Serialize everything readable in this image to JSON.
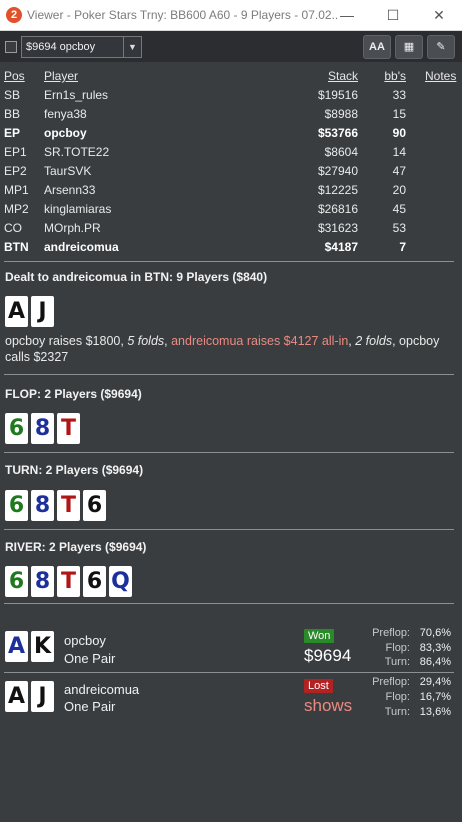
{
  "window": {
    "app_icon": "2",
    "title": "Viewer - Poker Stars Trny: BB600 A60 - 9 Players - 07.02....",
    "minimize": "—",
    "maximize": "☐",
    "close": "✕"
  },
  "toolbar": {
    "combo_value": "$9694 opcboy",
    "combo_arrow": "▼",
    "font_button": "AA",
    "grid_button": "▦",
    "edit_button": "✎"
  },
  "players": {
    "headers": {
      "pos": "Pos",
      "player": "Player",
      "stack": "Stack",
      "bbs": "bb's",
      "notes": "Notes"
    },
    "rows": [
      {
        "pos": "SB",
        "name": "Ern1s_rules",
        "stack": "$19516",
        "bbs": "33"
      },
      {
        "pos": "BB",
        "name": "fenya38",
        "stack": "$8988",
        "bbs": "15"
      },
      {
        "pos": "EP",
        "name": "opcboy",
        "stack": "$53766",
        "bbs": "90"
      },
      {
        "pos": "EP1",
        "name": "SR.TOTE22",
        "stack": "$8604",
        "bbs": "14"
      },
      {
        "pos": "EP2",
        "name": "TaurSVK",
        "stack": "$27940",
        "bbs": "47"
      },
      {
        "pos": "MP1",
        "name": "Arsenn33",
        "stack": "$12225",
        "bbs": "20"
      },
      {
        "pos": "MP2",
        "name": "kinglamiaras",
        "stack": "$26816",
        "bbs": "45"
      },
      {
        "pos": "CO",
        "name": "MOrph.PR",
        "stack": "$31623",
        "bbs": "53"
      },
      {
        "pos": "BTN",
        "name": "andreicomua",
        "stack": "$4187",
        "bbs": "7"
      }
    ]
  },
  "preflop": {
    "title": "Dealt to andreicomua in BTN: 9 Players ($840)",
    "cards": [
      "A",
      "J"
    ],
    "actions": {
      "a1": "opcboy raises $1800, ",
      "a2": "5 folds",
      "a3": ", ",
      "a4": "andreicomua raises $4127 all-in",
      "a5": ", ",
      "a6": "2 folds",
      "a7": ", opcboy calls $2327"
    }
  },
  "flop": {
    "title": "FLOP: 2 Players ($9694)",
    "cards": [
      "6",
      "8",
      "T"
    ]
  },
  "turn": {
    "title": "TURN: 2 Players ($9694)",
    "cards": [
      "6",
      "8",
      "T",
      "6"
    ]
  },
  "river": {
    "title": "RIVER: 2 Players ($9694)",
    "cards": [
      "6",
      "8",
      "T",
      "6",
      "Q"
    ]
  },
  "results": [
    {
      "cards": [
        "A",
        "K"
      ],
      "name": "opcboy",
      "hand": "One Pair",
      "badge": "Won",
      "amount": "$9694",
      "equity": {
        "preflop_label": "Preflop:",
        "preflop": "70,6%",
        "flop_label": "Flop:",
        "flop": "83,3%",
        "turn_label": "Turn:",
        "turn": "86,4%"
      }
    },
    {
      "cards": [
        "A",
        "J"
      ],
      "name": "andreicomua",
      "hand": "One Pair",
      "badge": "Lost",
      "amount": "shows",
      "equity": {
        "preflop_label": "Preflop:",
        "preflop": "29,4%",
        "flop_label": "Flop:",
        "flop": "16,7%",
        "turn_label": "Turn:",
        "turn": "13,6%"
      }
    }
  ],
  "colors": {
    "background": "#3a3d40",
    "toolbar": "#2b2d30",
    "highlight": "#e98b82",
    "won": "#2a8a2a",
    "lost": "#b22222",
    "club": "#1f7a1f",
    "diamond": "#1d2f9b",
    "heart": "#b01616",
    "spade": "#111111"
  }
}
